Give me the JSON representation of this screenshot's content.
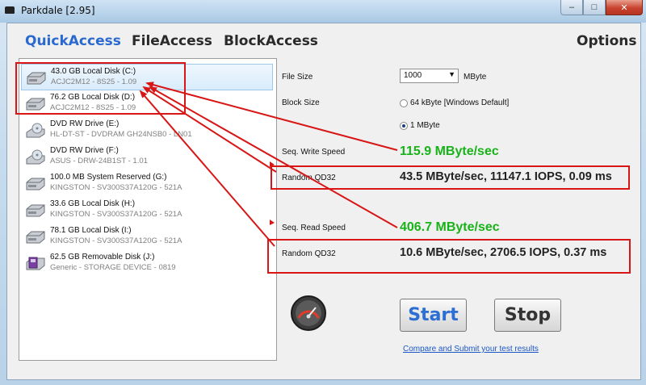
{
  "window": {
    "title": "Parkdale [2.95]",
    "controls": {
      "minimize": "–",
      "maximize": "□",
      "close": "✕"
    }
  },
  "menu": {
    "items": [
      "QuickAccess",
      "FileAccess",
      "BlockAccess"
    ],
    "options": "Options",
    "active_index": 0
  },
  "drives": [
    {
      "name": "43.0 GB Local Disk (C:)",
      "detail": "ACJC2M12 - 8S25 - 1.09",
      "icon": "hard-disk-icon",
      "selected": true
    },
    {
      "name": "76.2 GB Local Disk (D:)",
      "detail": "ACJC2M12 - 8S25 - 1.09",
      "icon": "hard-disk-icon"
    },
    {
      "name": "DVD RW Drive (E:)",
      "detail": "HL-DT-ST - DVDRAM GH24NSB0 - LN01",
      "icon": "dvd-drive-icon"
    },
    {
      "name": "DVD RW Drive (F:)",
      "detail": "ASUS - DRW-24B1ST - 1.01",
      "icon": "dvd-drive-icon"
    },
    {
      "name": "100.0 MB System Reserved (G:)",
      "detail": "KINGSTON - SV300S37A120G - 521A",
      "icon": "hard-disk-icon"
    },
    {
      "name": "33.6 GB Local Disk (H:)",
      "detail": "KINGSTON - SV300S37A120G - 521A",
      "icon": "hard-disk-icon"
    },
    {
      "name": "78.1 GB Local Disk (I:)",
      "detail": "KINGSTON - SV300S37A120G - 521A",
      "icon": "hard-disk-icon"
    },
    {
      "name": "62.5 GB Removable Disk (J:)",
      "detail": "Generic - STORAGE DEVICE - 0819",
      "icon": "removable-disk-icon"
    }
  ],
  "settings": {
    "file_size_label": "File Size",
    "file_size_value": "1000",
    "file_size_unit": "MByte",
    "block_size_label": "Block Size",
    "block_options": [
      {
        "label": "64 kByte [Windows Default]",
        "selected": false
      },
      {
        "label": "1 MByte",
        "selected": true
      }
    ]
  },
  "results": {
    "seq_write_label": "Seq. Write Speed",
    "seq_write_value": "115.9 MByte/sec",
    "rand_write_label": "Random QD32",
    "rand_write_value": "43.5 MByte/sec, 11147.1 IOPS, 0.09 ms",
    "seq_read_label": "Seq. Read Speed",
    "seq_read_value": "406.7 MByte/sec",
    "rand_read_label": "Random QD32",
    "rand_read_value": "10.6 MByte/sec, 2706.5 IOPS, 0.37 ms"
  },
  "actions": {
    "start": "Start",
    "stop": "Stop",
    "submit_link": "Compare and Submit your test results"
  },
  "colors": {
    "accent": "#2a6ad0",
    "result_green": "#18b318",
    "annotation_red": "#d81616"
  }
}
